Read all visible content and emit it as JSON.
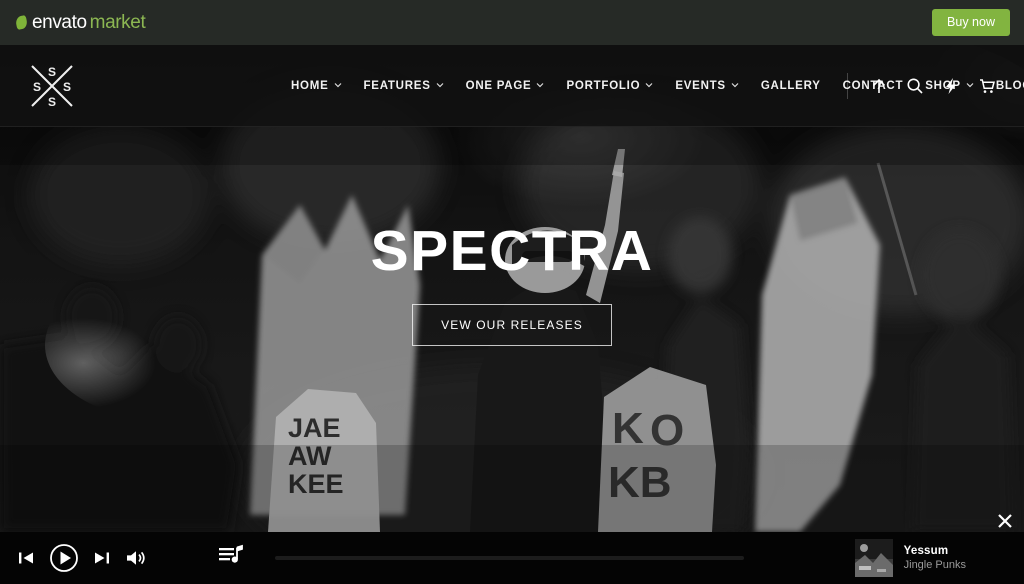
{
  "envato_bar": {
    "logo_primary": "envato",
    "logo_secondary": "market",
    "buy_now_label": "Buy now",
    "accent_green": "#82b440",
    "bar_background": "#262a26"
  },
  "navbar": {
    "logo_letters": [
      "S",
      "S",
      "S",
      "S"
    ],
    "items": [
      {
        "label": "HOME",
        "has_dropdown": true
      },
      {
        "label": "FEATURES",
        "has_dropdown": true
      },
      {
        "label": "ONE PAGE",
        "has_dropdown": true
      },
      {
        "label": "PORTFOLIO",
        "has_dropdown": true
      },
      {
        "label": "EVENTS",
        "has_dropdown": true
      },
      {
        "label": "GALLERY",
        "has_dropdown": false
      },
      {
        "label": "CONTACT",
        "has_dropdown": false
      },
      {
        "label": "SHOP",
        "has_dropdown": true
      },
      {
        "label": "BLOG",
        "has_dropdown": true
      }
    ],
    "icons": [
      "arrow-up-icon",
      "search-icon",
      "lightning-bolt-icon",
      "shopping-cart-icon"
    ]
  },
  "hero": {
    "title": "SPECTRA",
    "cta_label": "VEW OUR RELEASES",
    "slides_total": 3,
    "active_slide": 1
  },
  "player": {
    "controls": [
      "previous-track",
      "play",
      "next-track",
      "volume"
    ],
    "playlist_icon": "playlist-icon",
    "progress_percent": 0,
    "track": {
      "title": "Yessum",
      "artist": "Jingle Punks"
    },
    "close_label": "✕"
  }
}
